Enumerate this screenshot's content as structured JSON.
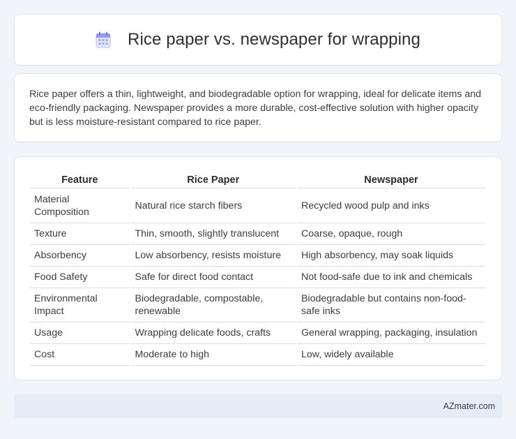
{
  "header": {
    "icon": "calendar-icon",
    "title": "Rice paper vs. newspaper for wrapping"
  },
  "summary": {
    "text": "Rice paper offers a thin, lightweight, and biodegradable option for wrapping, ideal for delicate items and eco-friendly packaging. Newspaper provides a more durable, cost-effective solution with higher opacity but is less moisture-resistant compared to rice paper."
  },
  "table": {
    "headers": [
      "Feature",
      "Rice Paper",
      "Newspaper"
    ],
    "rows": [
      [
        "Material Composition",
        "Natural rice starch fibers",
        "Recycled wood pulp and inks"
      ],
      [
        "Texture",
        "Thin, smooth, slightly translucent",
        "Coarse, opaque, rough"
      ],
      [
        "Absorbency",
        "Low absorbency, resists moisture",
        "High absorbency, may soak liquids"
      ],
      [
        "Food Safety",
        "Safe for direct food contact",
        "Not food-safe due to ink and chemicals"
      ],
      [
        "Environmental Impact",
        "Biodegradable, compostable, renewable",
        "Biodegradable but contains non-food-safe inks"
      ],
      [
        "Usage",
        "Wrapping delicate foods, crafts",
        "General wrapping, packaging, insulation"
      ],
      [
        "Cost",
        "Moderate to high",
        "Low, widely available"
      ]
    ]
  },
  "footer": {
    "brand": "AZmater.com"
  },
  "colors": {
    "background": "#f1f4f9",
    "card": "#ffffff",
    "footer": "#e6ecf7",
    "icon_accent": "#7b8de0"
  }
}
